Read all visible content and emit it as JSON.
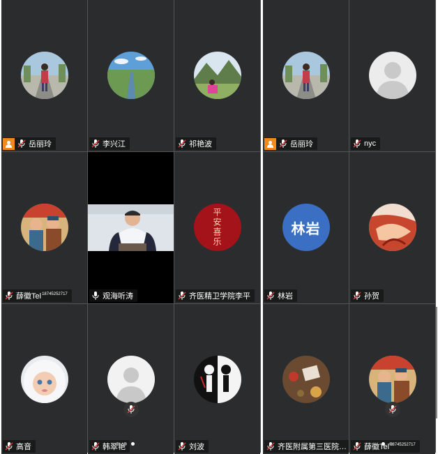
{
  "colors": {
    "tile_bg": "#2b2c2e",
    "speaking_border": "#2fb34a",
    "host_badge": "#f08a1c",
    "letter_avatar": "#3a6fc4"
  },
  "left_grid": [
    {
      "name": "岳丽玲",
      "host": true,
      "muted": true,
      "avatar": "woman-road-photo"
    },
    {
      "name": "李兴江",
      "host": false,
      "muted": true,
      "avatar": "river-landscape-photo"
    },
    {
      "name": "祁艳波",
      "host": false,
      "muted": true,
      "avatar": "mountain-woman-photo"
    },
    {
      "name": "薛徽Tel",
      "suffix": "18745252717",
      "host": false,
      "muted": true,
      "avatar": "poster-art"
    },
    {
      "name": "观海听涛",
      "host": false,
      "muted": false,
      "speaking": true,
      "avatar": "live-video"
    },
    {
      "name": "齐医精卫学院李平",
      "host": false,
      "muted": true,
      "avatar": "calligraphy-red",
      "calligraphy": "平安喜乐"
    },
    {
      "name": "高音",
      "host": false,
      "muted": true,
      "avatar": "baby-photo"
    },
    {
      "name": "韩翠艳",
      "host": false,
      "muted": true,
      "avatar": "default-person"
    },
    {
      "name": "刘波",
      "host": false,
      "muted": true,
      "avatar": "black-white-art"
    }
  ],
  "right_grid": [
    {
      "name": "岳丽玲",
      "host": true,
      "muted": true,
      "avatar": "woman-road-photo"
    },
    {
      "name": "nyc",
      "host": false,
      "muted": true,
      "avatar": "default-gray"
    },
    {
      "name": "林岩",
      "host": false,
      "muted": true,
      "avatar": "letter",
      "letter": "林岩"
    },
    {
      "name": "孙贺",
      "host": false,
      "muted": true,
      "avatar": "red-abstract"
    },
    {
      "name": "齐医附属第三医院孙...",
      "host": false,
      "muted": true,
      "avatar": "table-photo"
    },
    {
      "name": "薛徽Tel",
      "suffix": "18745252717",
      "host": false,
      "muted": true,
      "avatar": "poster-art"
    }
  ]
}
